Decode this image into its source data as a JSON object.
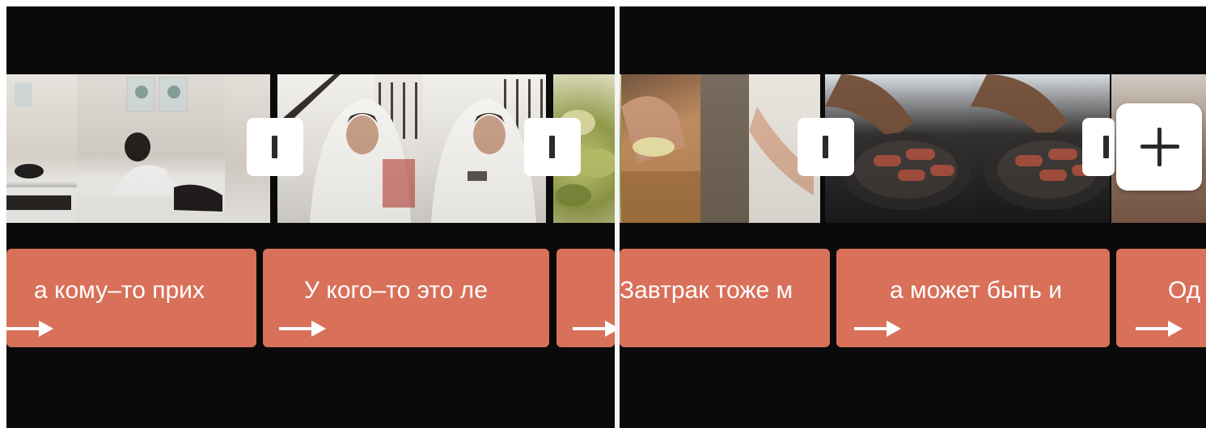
{
  "timeline": {
    "background": "#0b0a0a",
    "caption_color": "#d8705a",
    "playhead_color": "#f4f4f4",
    "clips": [
      {
        "name": "bedroom-clip",
        "scene": "woman waking up in bed"
      },
      {
        "name": "blanket-clip",
        "scene": "man wrapped in white blanket"
      },
      {
        "name": "pears-clip",
        "scene": "sliced pears"
      },
      {
        "name": "cutting-clip",
        "scene": "cutting on wooden board"
      },
      {
        "name": "frying-clip",
        "scene": "sausages in frying pan"
      },
      {
        "name": "next-clip",
        "scene": "next clip"
      }
    ],
    "captions": [
      {
        "text": "а кому–то прих",
        "icon": "arrow-right-icon"
      },
      {
        "text": "У кого–то это ле",
        "icon": "arrow-right-icon"
      },
      {
        "text": "",
        "icon": "arrow-right-icon"
      },
      {
        "text": "Завтрак тоже м",
        "icon": "none"
      },
      {
        "text": "а может быть и",
        "icon": "arrow-right-icon"
      },
      {
        "text": "Од",
        "icon": "arrow-right-icon"
      }
    ],
    "add_button_icon": "plus-icon",
    "divider_icon": "transition-icon"
  }
}
